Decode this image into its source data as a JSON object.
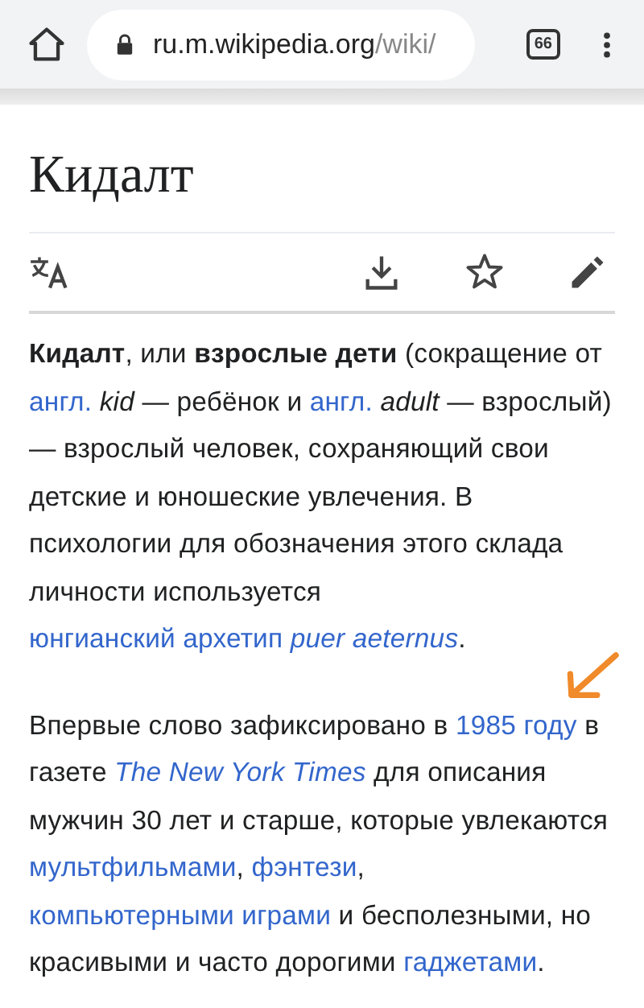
{
  "browser": {
    "url_host": "ru.m.wikipedia.org",
    "url_path": "/wiki/",
    "tab_count": "66"
  },
  "article": {
    "title": "Кидалт",
    "paragraphs": [
      [
        {
          "kind": "bold",
          "text": "Кидалт"
        },
        {
          "kind": "text",
          "text": ", или "
        },
        {
          "kind": "bold",
          "text": "взрослые дети"
        },
        {
          "kind": "text",
          "text": " (сокращение от "
        },
        {
          "kind": "link",
          "text": "англ."
        },
        {
          "kind": "text",
          "text": " *kid* — ребёнок и "
        },
        {
          "kind": "link",
          "text": "англ."
        },
        {
          "kind": "text",
          "text": " *adult* — взрослый) — взрослый человек, сохраняющий свои детские и юношеские увлечения. В психологии для обозначения этого склада личности используется "
        },
        {
          "kind": "link",
          "text": "юнгианский архетип *puer aeternus*"
        },
        {
          "kind": "text",
          "text": "."
        }
      ],
      [
        {
          "kind": "text",
          "text": "Впервые слово зафиксировано в "
        },
        {
          "kind": "link",
          "text": "1985 году"
        },
        {
          "kind": "text",
          "text": " в газете "
        },
        {
          "kind": "link",
          "text": "The New York Times",
          "italic": true
        },
        {
          "kind": "text",
          "text": " для описания мужчин 30 лет и старше, которые увлекаются "
        },
        {
          "kind": "link",
          "text": "мультфильмами"
        },
        {
          "kind": "text",
          "text": ", "
        },
        {
          "kind": "link",
          "text": "фэнтези"
        },
        {
          "kind": "text",
          "text": ", "
        },
        {
          "kind": "link",
          "text": "компьютерными играми"
        },
        {
          "kind": "text",
          "text": " и бесполезными, но красивыми и часто дорогими "
        },
        {
          "kind": "link",
          "text": "гаджетами"
        },
        {
          "kind": "text",
          "text": "."
        }
      ]
    ]
  }
}
